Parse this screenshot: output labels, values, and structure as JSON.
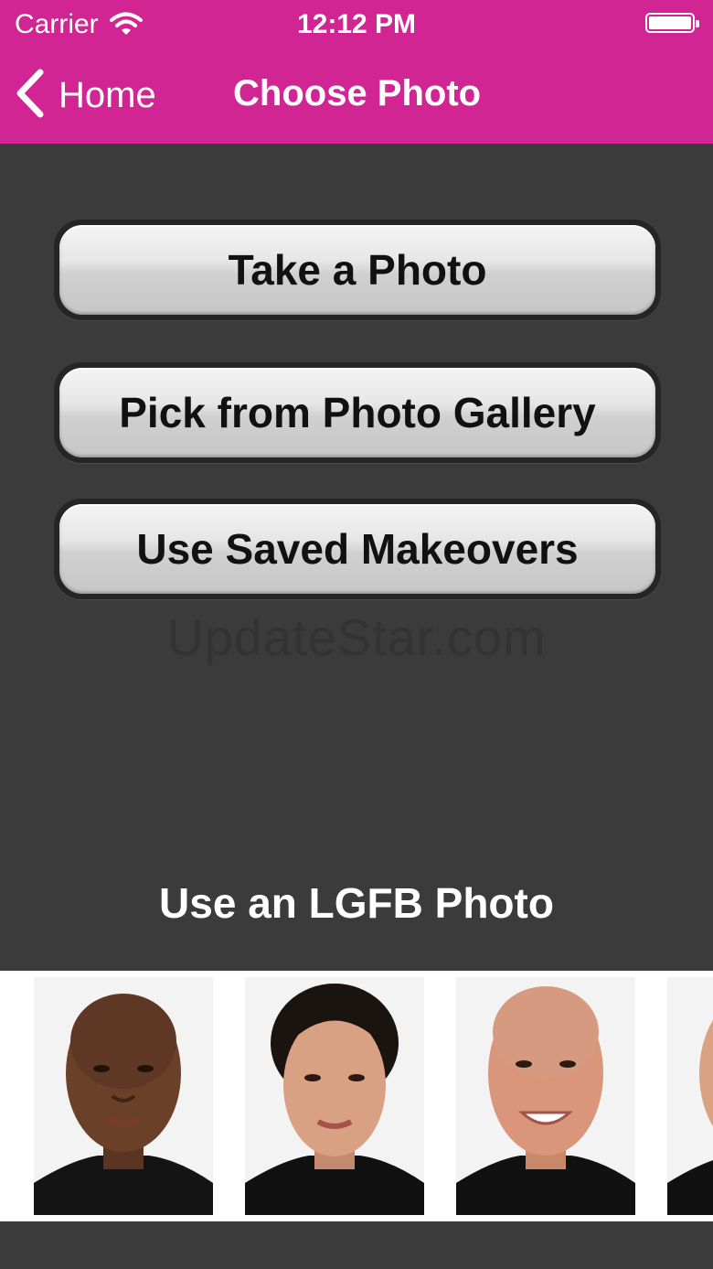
{
  "status_bar": {
    "carrier": "Carrier",
    "time": "12:12 PM",
    "wifi_icon": "wifi-icon",
    "battery_icon": "battery-icon",
    "battery_level": 1.0
  },
  "nav": {
    "back_label": "Home",
    "back_icon": "chevron-left-icon",
    "title": "Choose Photo"
  },
  "buttons": {
    "take_photo": "Take a Photo",
    "pick_gallery": "Pick from Photo Gallery",
    "saved_makeovers": "Use Saved Makeovers"
  },
  "watermark": "UpdateStar.com",
  "lgfb_section": {
    "title": "Use an LGFB Photo",
    "photos": [
      {
        "name": "lgfb-photo-1"
      },
      {
        "name": "lgfb-photo-2"
      },
      {
        "name": "lgfb-photo-3"
      },
      {
        "name": "lgfb-photo-4"
      }
    ]
  },
  "colors": {
    "accent": "#d02592",
    "background": "#3b3b3b",
    "button_text": "#111111"
  }
}
